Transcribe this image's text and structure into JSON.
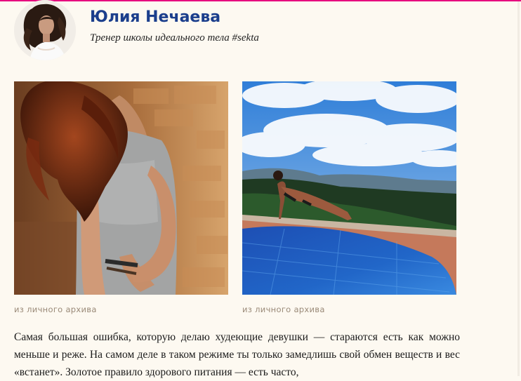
{
  "author": {
    "name": "Юлия Нечаева",
    "title": "Тренер школы идеального тела #sekta"
  },
  "photos": [
    {
      "caption": "из личного архива"
    },
    {
      "caption": "из личного архива"
    }
  ],
  "article": {
    "paragraph": "Самая большая ошибка, которую делаю худеющие девушки — стараются есть как можно меньше и реже. На самом деле в таком режиме ты только замедлишь свой обмен веществ и вес «встанет». Золотое правило здорового питания — есть часто,"
  },
  "colors": {
    "accent": "#e6007e",
    "name": "#1b3e8c",
    "caption": "#9a8a78",
    "background": "#fdf9f1"
  }
}
